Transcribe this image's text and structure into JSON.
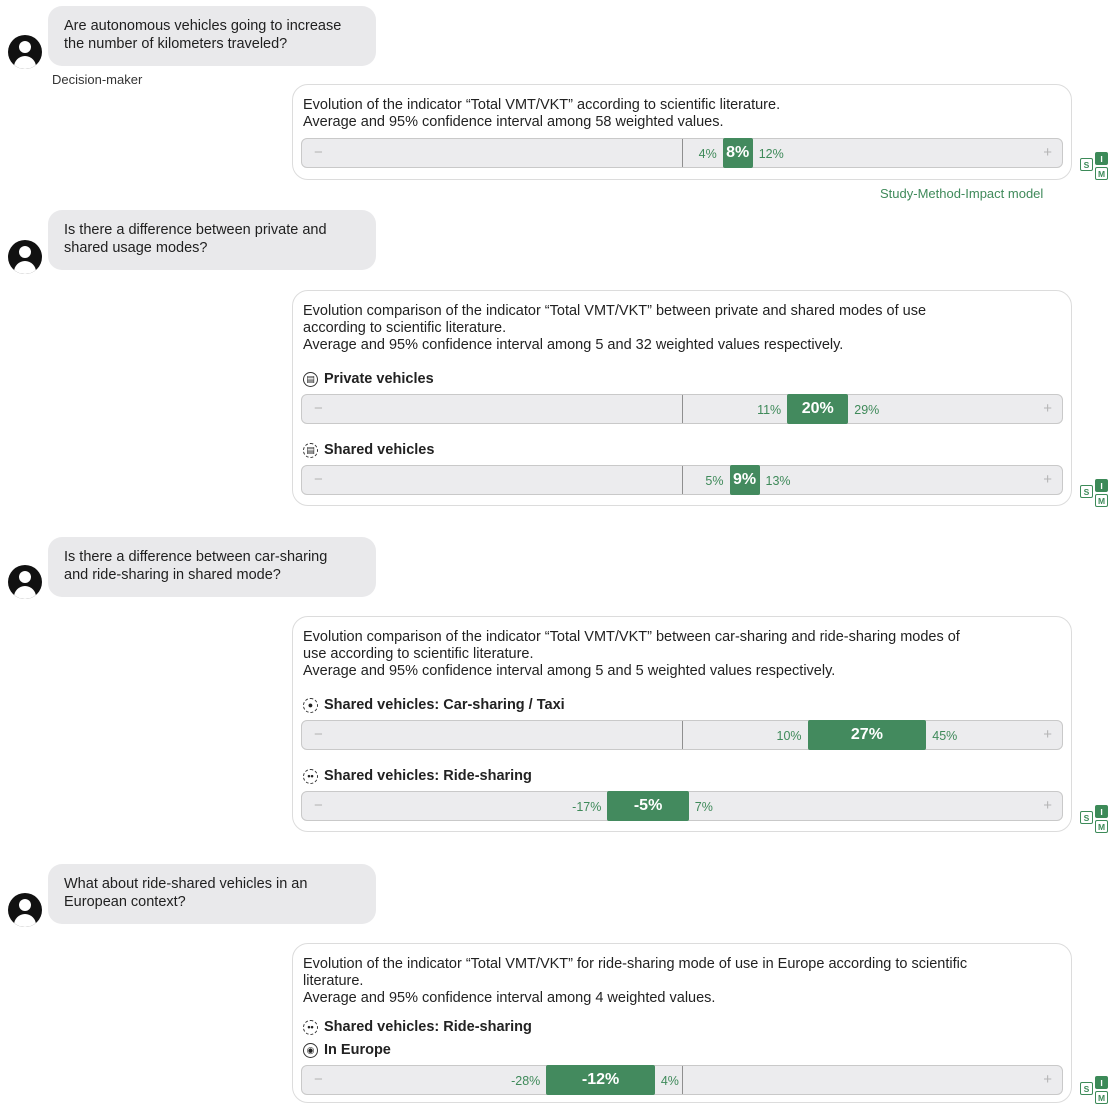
{
  "conversation": {
    "q1": {
      "line1": "Are autonomous vehicles going to increase",
      "line2": "the number of kilometers traveled?"
    },
    "role": "Decision-maker",
    "a1": {
      "line1": "Evolution of the indicator “Total VMT/VKT” according to scientific literature.",
      "line2": "Average and 95% confidence interval among 58 weighted values.",
      "bar": {
        "low": "4%",
        "mean": "8%",
        "high": "12%",
        "low_value": 4,
        "mean_value": 8,
        "high_value": 12
      }
    },
    "model_link": "Study-Method-Impact model",
    "q2": {
      "line1": "Is there a difference between private and",
      "line2": "shared usage modes?"
    },
    "a2": {
      "line1": "Evolution comparison of the indicator “Total VMT/VKT” between private and shared modes of use",
      "line2": "according to scientific literature.",
      "line3": "Average and 95% confidence interval among 5 and 32 weighted values respectively.",
      "private": {
        "label": "Private vehicles",
        "low": "11%",
        "mean": "20%",
        "high": "29%",
        "low_value": 11,
        "mean_value": 20,
        "high_value": 29
      },
      "shared": {
        "label": "Shared vehicles",
        "low": "5%",
        "mean": "9%",
        "high": "13%",
        "low_value": 5,
        "mean_value": 9,
        "high_value": 13
      }
    },
    "q3": {
      "line1": "Is there a difference between car-sharing",
      "line2": "and ride-sharing in shared mode?"
    },
    "a3": {
      "line1": "Evolution comparison of the indicator “Total VMT/VKT” between car-sharing and ride-sharing modes of",
      "line2": "use according to scientific literature.",
      "line3": "Average and 95% confidence interval among 5 and 5 weighted values respectively.",
      "carsharing": {
        "label": "Shared vehicles: Car-sharing / Taxi",
        "low": "10%",
        "mean": "27%",
        "high": "45%",
        "low_value": 10,
        "mean_value": 27,
        "high_value": 45
      },
      "ridesharing": {
        "label": "Shared vehicles: Ride-sharing",
        "low": "-17%",
        "mean": "-5%",
        "high": "7%",
        "low_value": -17,
        "mean_value": -5,
        "high_value": 7
      }
    },
    "q4": {
      "line1": "What about ride-shared vehicles in an",
      "line2": "European context?"
    },
    "a4": {
      "line1": "Evolution of the indicator “Total VMT/VKT” for ride-sharing mode of use in Europe according to scientific",
      "line2": "literature.",
      "line3": "Average and 95% confidence interval among 4 weighted values.",
      "segment": "Shared vehicles: Ride-sharing",
      "region": "In Europe",
      "bar": {
        "low": "-28%",
        "mean": "-12%",
        "high": "4%",
        "low_value": -28,
        "mean_value": -12,
        "high_value": 4
      }
    }
  },
  "badge": {
    "s": "S",
    "i": "I",
    "m": "M"
  },
  "track": {
    "minus": "−",
    "plus": "+"
  },
  "colors": {
    "accent": "#438a5e",
    "bubble": "#e9e9eb",
    "track": "#ececee"
  },
  "icons": [
    "user-avatar-icon",
    "car-icon",
    "globe-icon",
    "people-icon"
  ]
}
